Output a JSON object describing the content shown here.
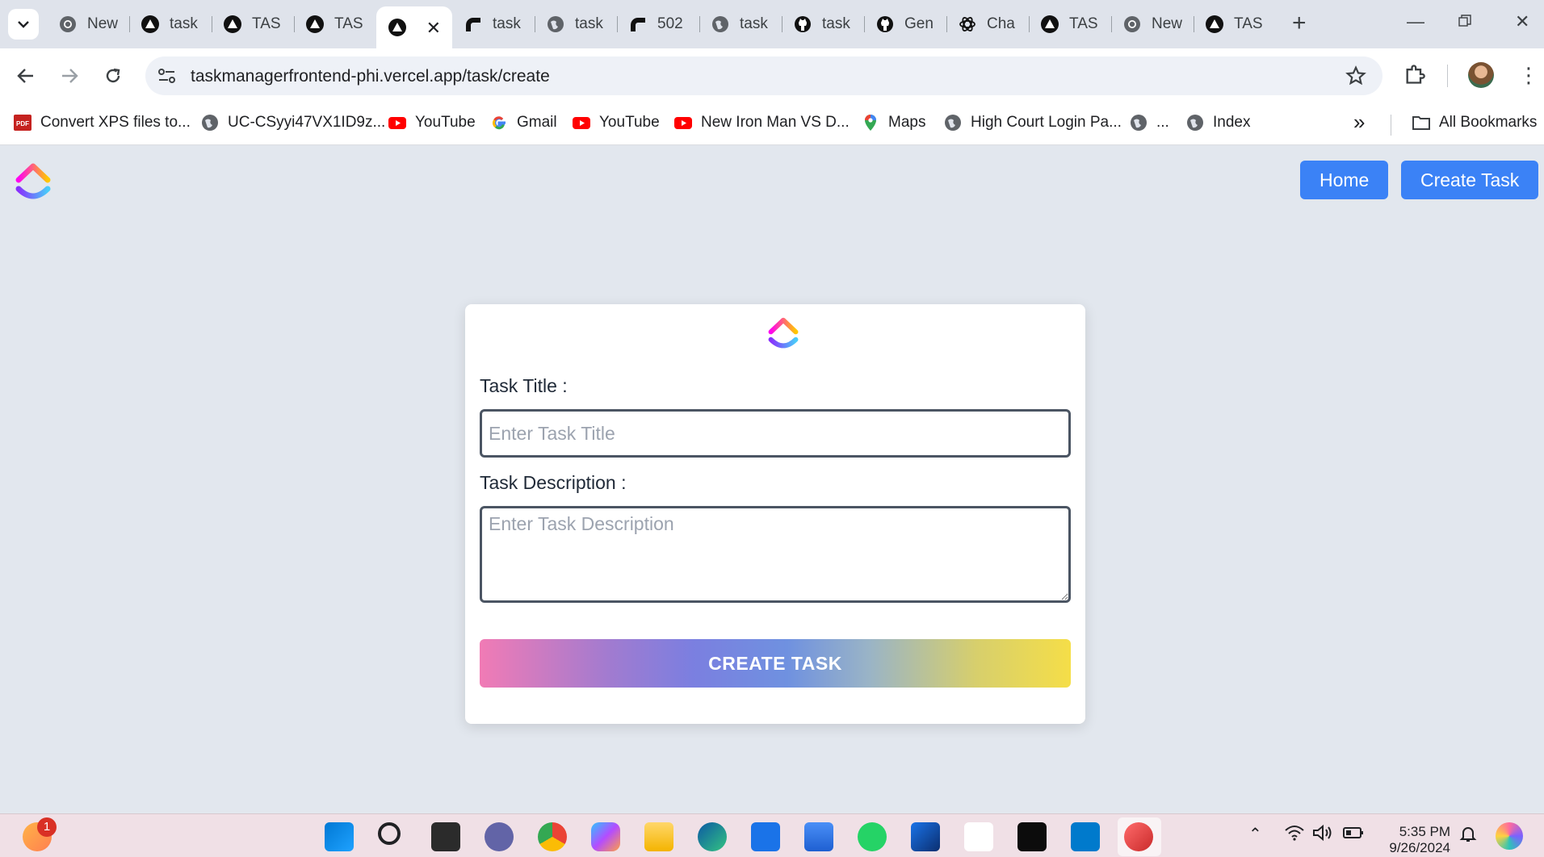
{
  "browser": {
    "tabs": [
      {
        "title": "New",
        "icon": "chrome-icon"
      },
      {
        "title": "task",
        "icon": "vercel-icon"
      },
      {
        "title": "TAS",
        "icon": "vercel-icon"
      },
      {
        "title": "TAS",
        "icon": "vercel-icon"
      },
      {
        "title": "",
        "icon": "vercel-icon",
        "active": true
      },
      {
        "title": "task",
        "icon": "render-icon"
      },
      {
        "title": "task",
        "icon": "globe-icon"
      },
      {
        "title": "502",
        "icon": "render-icon"
      },
      {
        "title": "task",
        "icon": "globe-icon"
      },
      {
        "title": "task",
        "icon": "github-icon"
      },
      {
        "title": "Gen",
        "icon": "github-icon"
      },
      {
        "title": "Cha",
        "icon": "openai-icon"
      },
      {
        "title": "TAS",
        "icon": "vercel-icon"
      },
      {
        "title": "New",
        "icon": "chrome-icon"
      },
      {
        "title": "TAS",
        "icon": "vercel-icon"
      }
    ],
    "url": "taskmanagerfrontend-phi.vercel.app/task/create",
    "bookmarks": [
      {
        "label": "Convert XPS files to...",
        "icon": "pdf-icon"
      },
      {
        "label": "UC-CSyyi47VX1ID9z...",
        "icon": "globe-icon"
      },
      {
        "label": "YouTube",
        "icon": "youtube-icon"
      },
      {
        "label": "Gmail",
        "icon": "google-icon"
      },
      {
        "label": "YouTube",
        "icon": "youtube-icon"
      },
      {
        "label": "New Iron Man VS D...",
        "icon": "youtube-icon"
      },
      {
        "label": "Maps",
        "icon": "maps-icon"
      },
      {
        "label": "High Court Login Pa...",
        "icon": "globe-icon"
      },
      {
        "label": "...",
        "icon": "globe-icon"
      },
      {
        "label": "Index",
        "icon": "globe-icon"
      }
    ],
    "all_bookmarks_label": "All Bookmarks"
  },
  "app": {
    "nav": {
      "home_label": "Home",
      "create_label": "Create Task"
    },
    "form": {
      "title_label": "Task Title :",
      "title_placeholder": "Enter Task Title",
      "title_value": "",
      "desc_label": "Task Description :",
      "desc_placeholder": "Enter Task Description",
      "desc_value": "",
      "submit_label": "CREATE TASK"
    }
  },
  "taskbar": {
    "time": "5:35 PM",
    "date": "9/26/2024",
    "notification_badge": "1",
    "apps": [
      "widgets-icon",
      "start-icon",
      "search-icon",
      "task-view-icon",
      "teams-icon",
      "chrome-icon",
      "copilot-icon",
      "file-explorer-icon",
      "edge-icon",
      "mail-icon",
      "store-icon",
      "whatsapp-icon",
      "bird-app-icon",
      "clickup-icon",
      "terminal-icon",
      "vscode-icon",
      "snipping-tool-icon"
    ]
  },
  "colors": {
    "accent": "#3b82f6",
    "page_bg": "#e2e7ee",
    "tabstrip_bg": "#dfe3eb"
  }
}
